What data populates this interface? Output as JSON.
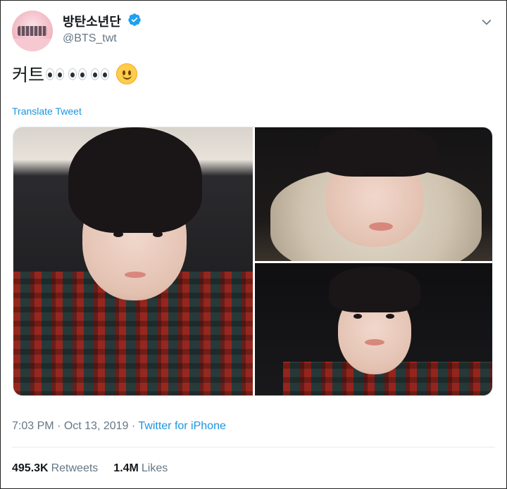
{
  "user": {
    "display_name": "방탄소년단",
    "handle": "@BTS_twt",
    "verified": true
  },
  "tweet": {
    "text": "커트",
    "emoji_sequence": [
      "eyes-icon",
      "eyes-icon",
      "eyes-icon",
      "slightly-smiling-face-icon"
    ],
    "translate_label": "Translate Tweet",
    "media": [
      {
        "name": "photo-1"
      },
      {
        "name": "photo-2"
      },
      {
        "name": "photo-3"
      }
    ]
  },
  "meta": {
    "time": "7:03 PM",
    "sep1": " · ",
    "date": "Oct 13, 2019",
    "sep2": " · ",
    "source": "Twitter for iPhone"
  },
  "stats": {
    "retweets_count": "495.3K",
    "retweets_label": "Retweets",
    "likes_count": "1.4M",
    "likes_label": "Likes"
  },
  "colors": {
    "link": "#1b95e0",
    "muted": "#657786",
    "text": "#14171a",
    "verified": "#1da1f2"
  }
}
